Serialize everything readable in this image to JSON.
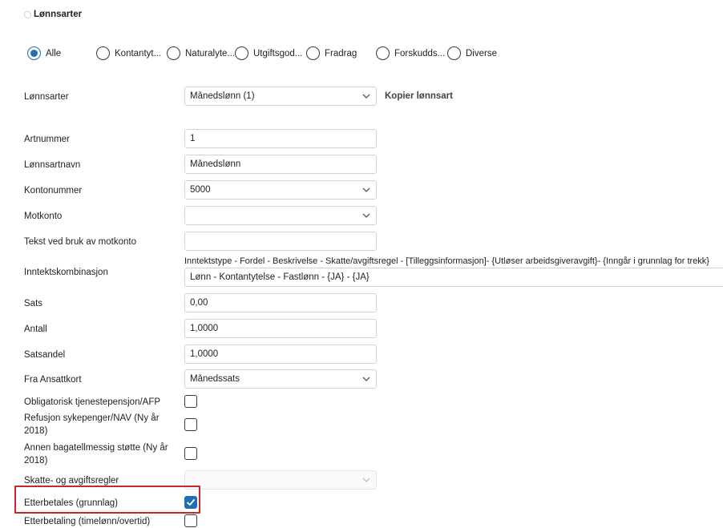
{
  "header": {
    "title": "Lønnsarter",
    "icon": "gear-icon"
  },
  "filters": [
    {
      "label": "Alle",
      "selected": true
    },
    {
      "label": "Kontantyt...",
      "selected": false
    },
    {
      "label": "Naturalyte...",
      "selected": false
    },
    {
      "label": "Utgiftsgod...",
      "selected": false
    },
    {
      "label": "Fradrag",
      "selected": false
    },
    {
      "label": "Forskudds...",
      "selected": false
    },
    {
      "label": "Diverse",
      "selected": false
    }
  ],
  "lonnsarter": {
    "label": "Lønnsarter",
    "value": "Månedslønn (1)",
    "copy_label": "Kopier lønnsart"
  },
  "fields": {
    "artnummer": {
      "label": "Artnummer",
      "value": "1"
    },
    "navn": {
      "label": "Lønnsartnavn",
      "value": "Månedslønn"
    },
    "kontonummer": {
      "label": "Kontonummer",
      "value": "5000"
    },
    "motkonto": {
      "label": "Motkonto",
      "value": ""
    },
    "tekst_motkonto": {
      "label": "Tekst ved bruk av motkonto",
      "value": ""
    },
    "inntektskombinasjon": {
      "label": "Inntektskombinasjon",
      "header": "Inntektstype - Fordel - Beskrivelse - Skatte/avgiftsregel - [Tilleggsinformasjon]- {Utløser arbeidsgiveravgift}- {Inngår i grunnlag for trekk}",
      "value": "Lønn - Kontantytelse - Fastlønn - {JA} - {JA}"
    },
    "sats": {
      "label": "Sats",
      "value": "0,00"
    },
    "antall": {
      "label": "Antall",
      "value": "1,0000"
    },
    "satsandel": {
      "label": "Satsandel",
      "value": "1,0000"
    },
    "fra_ansattkort": {
      "label": "Fra Ansattkort",
      "value": "Månedssats"
    },
    "skatte_avgiftsregler": {
      "label": "Skatte- og avgiftsregler",
      "value": ""
    }
  },
  "checkboxes": {
    "otp": {
      "label": "Obligatorisk tjenestepensjon/AFP",
      "checked": false
    },
    "refusjon": {
      "label": "Refusjon sykepenger/NAV (Ny år 2018)",
      "checked": false
    },
    "bagatell": {
      "label": "Annen bagatellmessig støtte (Ny år 2018)",
      "checked": false
    },
    "etterbetales": {
      "label": "Etterbetales (grunnlag)",
      "checked": true
    },
    "etterbetaling": {
      "label": "Etterbetaling (timelønn/overtid)",
      "checked": false
    }
  },
  "colors": {
    "accent": "#1f6fb2",
    "highlight": "#c62828",
    "border": "#cfd4da"
  }
}
